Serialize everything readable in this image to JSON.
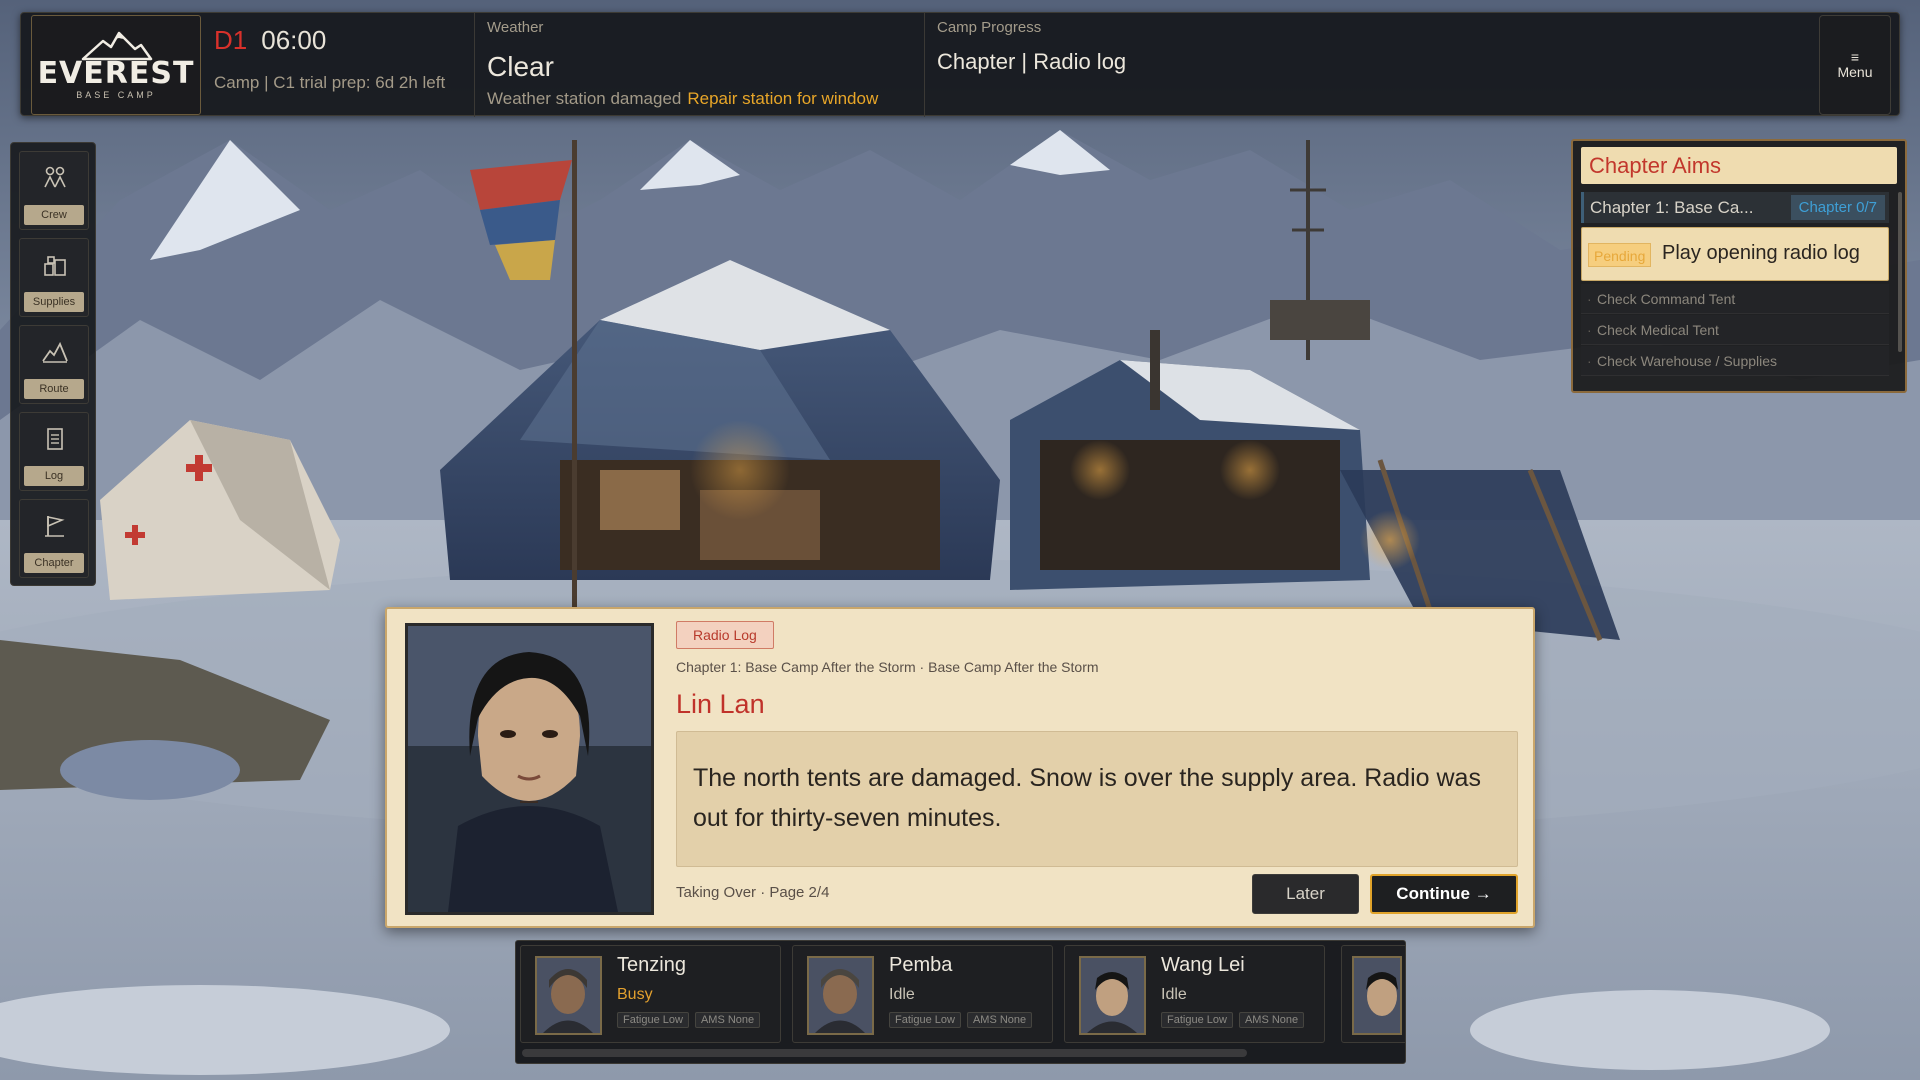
{
  "topbar": {
    "logo_title": "EVEREST",
    "logo_sub": "BASE CAMP",
    "day": "D1",
    "time": "06:00",
    "camp_info": "Camp | C1 trial prep: 6d 2h left",
    "weather_label": "Weather",
    "weather_value": "Clear",
    "weather_warning": "Weather station damaged",
    "weather_action": "Repair station for window",
    "progress_label": "Camp Progress",
    "progress_value": "Chapter | Radio log",
    "menu_icon": "≡",
    "menu_label": "Menu"
  },
  "sidebar": {
    "items": [
      {
        "label": "Crew",
        "icon": "crew-icon"
      },
      {
        "label": "Supplies",
        "icon": "supplies-icon"
      },
      {
        "label": "Route",
        "icon": "route-icon"
      },
      {
        "label": "Log",
        "icon": "log-icon"
      },
      {
        "label": "Chapter",
        "icon": "flag-icon"
      }
    ]
  },
  "aims": {
    "title": "Chapter Aims",
    "chapter": "Chapter 1: Base Ca...",
    "chapter_count": "Chapter 0/7",
    "pending_badge": "Pending",
    "pending_task": "Play opening radio log",
    "items": [
      "Check Command Tent",
      "Check Medical Tent",
      "Check Warehouse / Supplies"
    ]
  },
  "dialog": {
    "tag": "Radio Log",
    "subtitle": "Chapter 1: Base Camp After the Storm · Base Camp After the Storm",
    "speaker": "Lin Lan",
    "text": "The north tents are damaged. Snow is over the supply area. Radio was out for thirty-seven minutes.",
    "page_info": "Taking Over · Page 2/4",
    "later_label": "Later",
    "continue_label": "Continue →"
  },
  "crew": [
    {
      "name": "Tenzing",
      "status": "Busy",
      "status_color": "#e3a02e",
      "fatigue": "Fatigue Low",
      "ams": "AMS None"
    },
    {
      "name": "Pemba",
      "status": "Idle",
      "status_color": "#c9c3b6",
      "fatigue": "Fatigue Low",
      "ams": "AMS None"
    },
    {
      "name": "Wang Lei",
      "status": "Idle",
      "status_color": "#c9c3b6",
      "fatigue": "Fatigue Low",
      "ams": "AMS None"
    }
  ],
  "colors": {
    "accent_gold": "#e0a32a",
    "accent_red": "#c0322a",
    "panel_dark": "#16181c",
    "parchment": "#f1e3c4"
  }
}
